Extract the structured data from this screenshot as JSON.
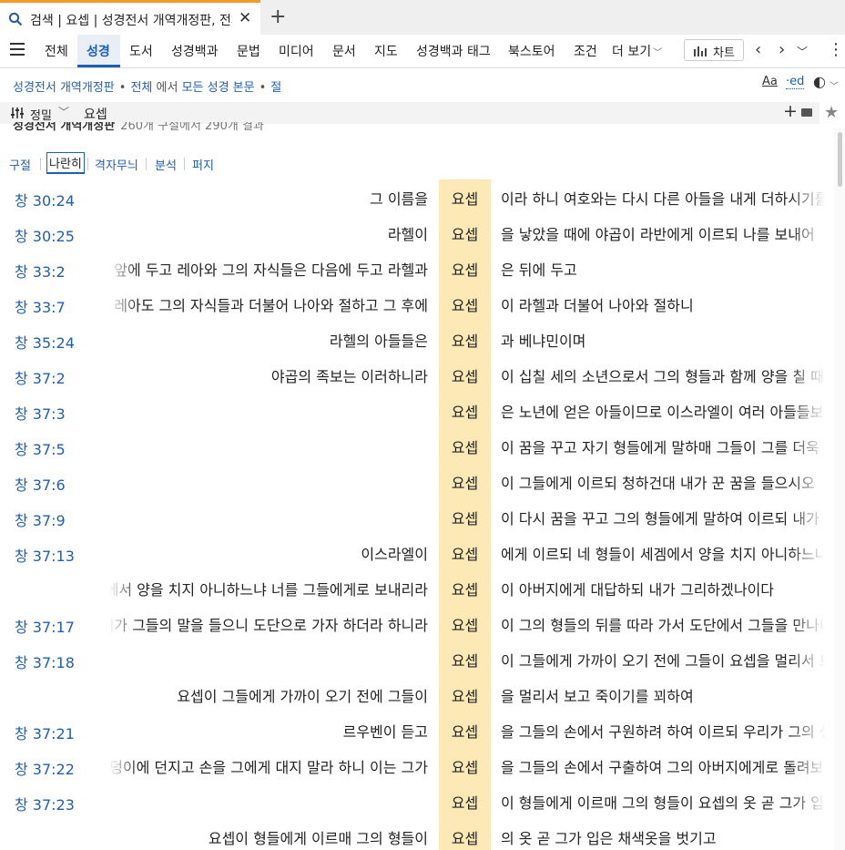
{
  "tab": {
    "title": "검색 | 요셉 | 성경전서 개역개정판, 전체",
    "close_icon": "close-icon",
    "new_tab_icon": "plus-icon"
  },
  "nav": {
    "items": [
      "전체",
      "성경",
      "도서",
      "성경백과",
      "문법",
      "미디어",
      "문서",
      "지도",
      "성경백과 태그",
      "북스토어",
      "조건",
      "더 보기"
    ],
    "active": "성경",
    "chart_label": "차트"
  },
  "breadcrumb": {
    "bible": "성경전서 개역개정판",
    "scope": "전체",
    "in_text": "에서",
    "target": "모든 성경 본문",
    "unit": "절"
  },
  "search": {
    "sort_label": "정밀",
    "query": "요셉"
  },
  "results_header": {
    "title": "성경전서 개역개정판",
    "count": "260개 구절에서 290개 결과"
  },
  "view_tabs": [
    "구절",
    "나란히",
    "격자무늬",
    "분석",
    "퍼지"
  ],
  "active_view": "나란히",
  "keyword_color": "#fde9b5",
  "rows": [
    {
      "ref": "창 30:24",
      "left": "그 이름을",
      "kw": "요셉",
      "right": "이라 하니 여호와는 다시 다른 아들을 내게 더하시기를"
    },
    {
      "ref": "창 30:25",
      "left": "라헬이",
      "kw": "요셉",
      "right": "을 낳았을 때에 야곱이 라반에게 이르되 나를 보내어"
    },
    {
      "ref": "창 33:2",
      "left": "여종들과 그들의 자식들은 앞에 두고 레아와 그의 자식들은 다음에 두고 라헬과",
      "kw": "요셉",
      "right": "은 뒤에 두고"
    },
    {
      "ref": "창 33:7",
      "left": "레아도 그의 자식들과 더불어 나아와 절하고 그 후에",
      "kw": "요셉",
      "right": "이 라헬과 더불어 나아와 절하니"
    },
    {
      "ref": "창 35:24",
      "left": "라헬의 아들들은",
      "kw": "요셉",
      "right": "과 베냐민이며"
    },
    {
      "ref": "창 37:2",
      "left": "야곱의 족보는 이러하니라",
      "kw": "요셉",
      "right": "이 십칠 세의 소년으로서 그의 형들과 함께 양을 칠 때에"
    },
    {
      "ref": "창 37:3",
      "left": "",
      "kw": "요셉",
      "right": "은 노년에 얻은 아들이므로 이스라엘이 여러 아들들보다"
    },
    {
      "ref": "창 37:5",
      "left": "",
      "kw": "요셉",
      "right": "이 꿈을 꾸고 자기 형들에게 말하매 그들이 그를 더욱"
    },
    {
      "ref": "창 37:6",
      "left": "",
      "kw": "요셉",
      "right": "이 그들에게 이르되 청하건대 내가 꾼 꿈을 들으시오"
    },
    {
      "ref": "창 37:9",
      "left": "",
      "kw": "요셉",
      "right": "이 다시 꿈을 꾸고 그의 형들에게 말하여 이르되 내가"
    },
    {
      "ref": "창 37:13",
      "left": "이스라엘이",
      "kw": "요셉",
      "right": "에게 이르되 네 형들이 세겜에서 양을 치지 아니하느냐"
    },
    {
      "ref": "",
      "left": "네 형들이 세겜에서 양을 치지 아니하느냐 너를 그들에게로 보내리라",
      "kw": "요셉",
      "right": "이 아버지에게 대답하되 내가 그리하겠나이다"
    },
    {
      "ref": "창 37:17",
      "left": "그 사람이 이르되 그들이 여기서 떠났느니라 내가 그들의 말을 들으니 도단으로 가자 하더라 하니라",
      "kw": "요셉",
      "right": "이 그의 형들의 뒤를 따라 가서 도단에서 그들을 만나니라"
    },
    {
      "ref": "창 37:18",
      "left": "",
      "kw": "요셉",
      "right": "이 그들에게 가까이 오기 전에 그들이 요셉을 멀리서 보고"
    },
    {
      "ref": "",
      "left": "요셉이 그들에게 가까이 오기 전에 그들이",
      "kw": "요셉",
      "right": "을 멀리서 보고 죽이기를 꾀하여"
    },
    {
      "ref": "창 37:21",
      "left": "르우벤이 듣고",
      "kw": "요셉",
      "right": "을 그들의 손에서 구원하려 하여 이르되 우리가 그의 생명은"
    },
    {
      "ref": "창 37:22",
      "left": "르우벤이 또 그들에게 이르되 피를 흘리지 말라 그를 광야 그 구덩이에 던지고 손을 그에게 대지 말라 하니 이는 그가",
      "kw": "요셉",
      "right": "을 그들의 손에서 구출하여 그의 아버지에게로 돌려보내려"
    },
    {
      "ref": "창 37:23",
      "left": "",
      "kw": "요셉",
      "right": "이 형들에게 이르매 그의 형들이 요셉의 옷 곧 그가 입은"
    },
    {
      "ref": "",
      "left": "요셉이 형들에게 이르매 그의 형들이",
      "kw": "요셉",
      "right": "의 옷 곧 그가 입은 채색옷을 벗기고"
    }
  ]
}
